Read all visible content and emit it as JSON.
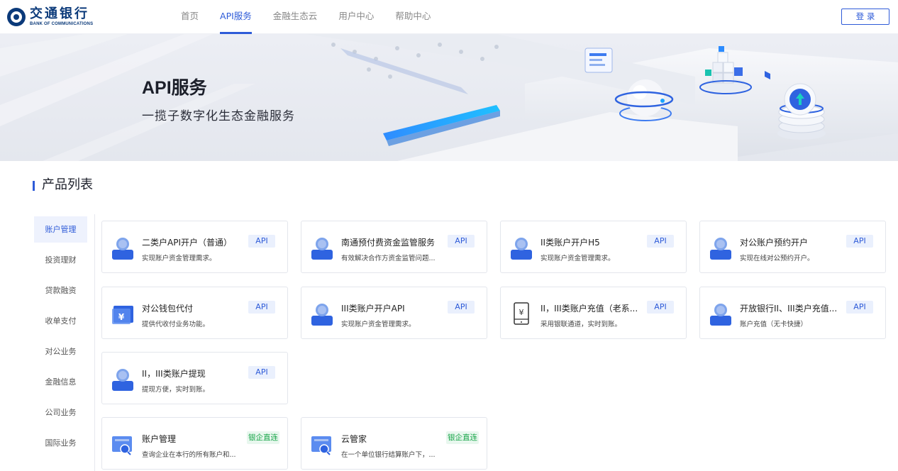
{
  "header": {
    "logo_cn": "交通银行",
    "logo_en": "BANK OF COMMUNICATIONS",
    "nav": [
      {
        "label": "首页",
        "active": false
      },
      {
        "label": "API服务",
        "active": true
      },
      {
        "label": "金融生态云",
        "active": false
      },
      {
        "label": "用户中心",
        "active": false
      },
      {
        "label": "帮助中心",
        "active": false
      }
    ],
    "login_label": "登 录"
  },
  "banner": {
    "title": "API服务",
    "subtitle": "一揽子数字化生态金融服务"
  },
  "section": {
    "title": "产品列表"
  },
  "sidebar": {
    "items": [
      {
        "label": "账户管理",
        "active": true
      },
      {
        "label": "投资理财",
        "active": false
      },
      {
        "label": "贷款融资",
        "active": false
      },
      {
        "label": "收单支付",
        "active": false
      },
      {
        "label": "对公业务",
        "active": false
      },
      {
        "label": "金融信息",
        "active": false
      },
      {
        "label": "公司业务",
        "active": false
      },
      {
        "label": "国际业务",
        "active": false
      }
    ]
  },
  "cards": [
    {
      "title": "二类户API开户（普通）",
      "desc": "实现账户资金管理需求。",
      "tag": "API",
      "icon": "person-icon"
    },
    {
      "title": "南通预付费资金监管服务",
      "desc": "有效解决合作方资金监管问题...",
      "tag": "API",
      "icon": "person-icon"
    },
    {
      "title": "II类账户开户H5",
      "desc": "实现账户资金管理需求。",
      "tag": "API",
      "icon": "person-icon"
    },
    {
      "title": "对公账户预约开户",
      "desc": "实现在线对公预约开户。",
      "tag": "API",
      "icon": "person-icon"
    },
    {
      "title": "对公钱包代付",
      "desc": "提供代收付业务功能。",
      "tag": "API",
      "icon": "yuan-card-icon"
    },
    {
      "title": "III类账户开户API",
      "desc": "实现账户资金管理需求。",
      "tag": "API",
      "icon": "person-icon"
    },
    {
      "title": "II，III类账户充值（老系...",
      "desc": "采用银联通道，实时到账。",
      "tag": "API",
      "icon": "yuan-phone-icon"
    },
    {
      "title": "开放银行II、III类户充值...",
      "desc": "账户充值（无卡快捷）",
      "tag": "API",
      "icon": "person-icon"
    },
    {
      "title": "II，III类账户提现",
      "desc": "提现方便，实时到账。",
      "tag": "API",
      "icon": "person-icon"
    },
    {
      "title": "账户管理",
      "desc": "查询企业在本行的所有账户和...",
      "tag": "银企直连",
      "icon": "account-search-icon"
    },
    {
      "title": "云管家",
      "desc": "在一个单位银行结算账户下，...",
      "tag": "银企直连",
      "icon": "account-search-icon"
    }
  ],
  "colors": {
    "brand": "#0b3a7a",
    "accent": "#2e5bd8",
    "tag_green": "#1aa64a"
  }
}
